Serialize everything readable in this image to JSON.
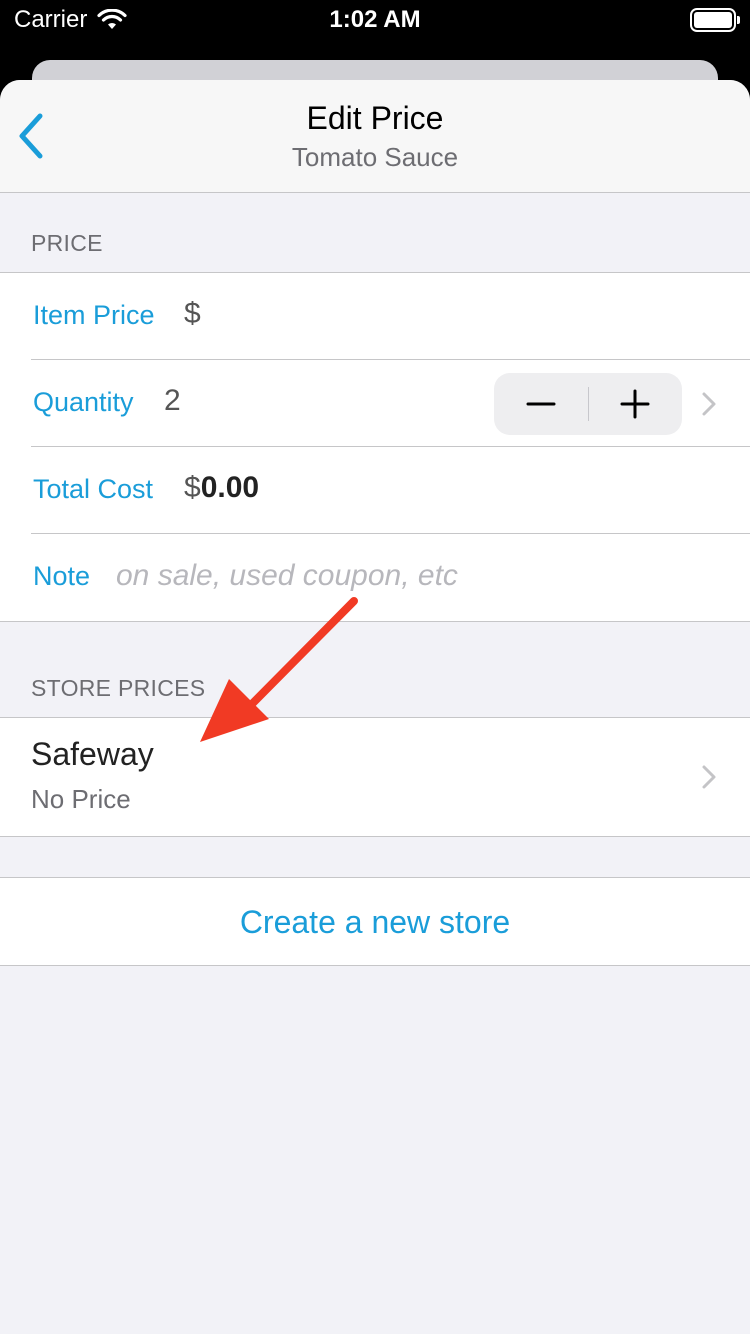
{
  "status_bar": {
    "carrier": "Carrier",
    "time": "1:02 AM"
  },
  "nav": {
    "title": "Edit Price",
    "subtitle": "Tomato Sauce"
  },
  "price_section": {
    "header": "PRICE",
    "item_price": {
      "label": "Item Price",
      "currency": "$",
      "value": ""
    },
    "quantity": {
      "label": "Quantity",
      "value": "2"
    },
    "total_cost": {
      "label": "Total Cost",
      "currency": "$",
      "value": "0.00"
    },
    "note": {
      "label": "Note",
      "placeholder": "on sale, used coupon, etc"
    }
  },
  "store_prices": {
    "header": "STORE PRICES",
    "stores": [
      {
        "name": "Safeway",
        "price": "No Price"
      }
    ]
  },
  "create_store_label": "Create a new store",
  "colors": {
    "accent": "#1a9dd9",
    "annotation_arrow": "#f13a24",
    "background": "#f2f2f7"
  },
  "icons": [
    "wifi-icon",
    "battery-icon",
    "back-chevron-icon",
    "minus-icon",
    "plus-icon",
    "chevron-right-icon",
    "annotation-arrow"
  ]
}
